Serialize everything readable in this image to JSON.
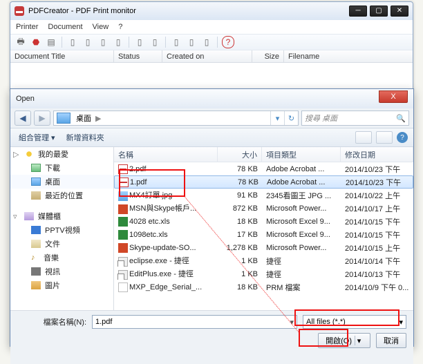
{
  "pdfcreator": {
    "title": "PDFCreator - PDF Print monitor",
    "menu": {
      "printer": "Printer",
      "document": "Document",
      "view": "View",
      "help": "?"
    },
    "toolbar_question": "?",
    "cols": {
      "title": "Document Title",
      "status": "Status",
      "created": "Created on",
      "size": "Size",
      "filename": "Filename"
    }
  },
  "open": {
    "title": "Open",
    "x": "X",
    "nav_back": "◀",
    "addr": {
      "crumb": "桌面",
      "sep": "▶"
    },
    "refresh": "↻",
    "search_placeholder": "搜尋 桌面",
    "search_icon": "🔍",
    "cmd": {
      "org": "組合管理 ▾",
      "newfolder": "新增資料夾",
      "help": "?"
    },
    "navpane": {
      "fav": "我的最愛",
      "downloads": "下載",
      "desktop": "桌面",
      "recent": "最近的位置",
      "lib": "媒體櫃",
      "pptv": "PPTV視頻",
      "docs": "文件",
      "music": "音樂",
      "video": "視訊",
      "pics": "圖片"
    },
    "cols": {
      "name": "名稱",
      "size": "大小",
      "type": "項目類型",
      "date": "修改日期"
    },
    "files": [
      {
        "name": "2.pdf",
        "size": "78 KB",
        "type": "Adobe Acrobat ...",
        "date": "2014/10/23 下午",
        "icon": "pdf"
      },
      {
        "name": "1.pdf",
        "size": "78 KB",
        "type": "Adobe Acrobat ...",
        "date": "2014/10/23 下午",
        "icon": "pdf",
        "sel": true
      },
      {
        "name": "MX4訂單.jpg",
        "size": "91 KB",
        "type": "2345看圖王 JPG ...",
        "date": "2014/10/22 上午",
        "icon": "jpg"
      },
      {
        "name": "MSN與Skype帳戶...",
        "size": "872 KB",
        "type": "Microsoft Power...",
        "date": "2014/10/17 上午",
        "icon": "ppt"
      },
      {
        "name": "4028 etc.xls",
        "size": "18 KB",
        "type": "Microsoft Excel 9...",
        "date": "2014/10/15 下午",
        "icon": "xls"
      },
      {
        "name": "1098etc.xls",
        "size": "17 KB",
        "type": "Microsoft Excel 9...",
        "date": "2014/10/15 下午",
        "icon": "xls"
      },
      {
        "name": "Skype-update-SO...",
        "size": "1,278 KB",
        "type": "Microsoft Power...",
        "date": "2014/10/15 上午",
        "icon": "ppt"
      },
      {
        "name": "eclipse.exe - 捷徑",
        "size": "1 KB",
        "type": "捷徑",
        "date": "2014/10/14 下午",
        "icon": "exe"
      },
      {
        "name": "EditPlus.exe - 捷徑",
        "size": "1 KB",
        "type": "捷徑",
        "date": "2014/10/13 下午",
        "icon": "exe"
      },
      {
        "name": "MXP_Edge_Serial_...",
        "size": "18 KB",
        "type": "PRM 檔案",
        "date": "2014/10/9 下午 0...",
        "icon": "file"
      }
    ],
    "filename_label": "檔案名稱(N):",
    "filename_value": "1.pdf",
    "filetype": "All files (*.*)",
    "open_btn": "開啟(O)",
    "split_caret": "▾",
    "cancel_btn": "取消"
  }
}
